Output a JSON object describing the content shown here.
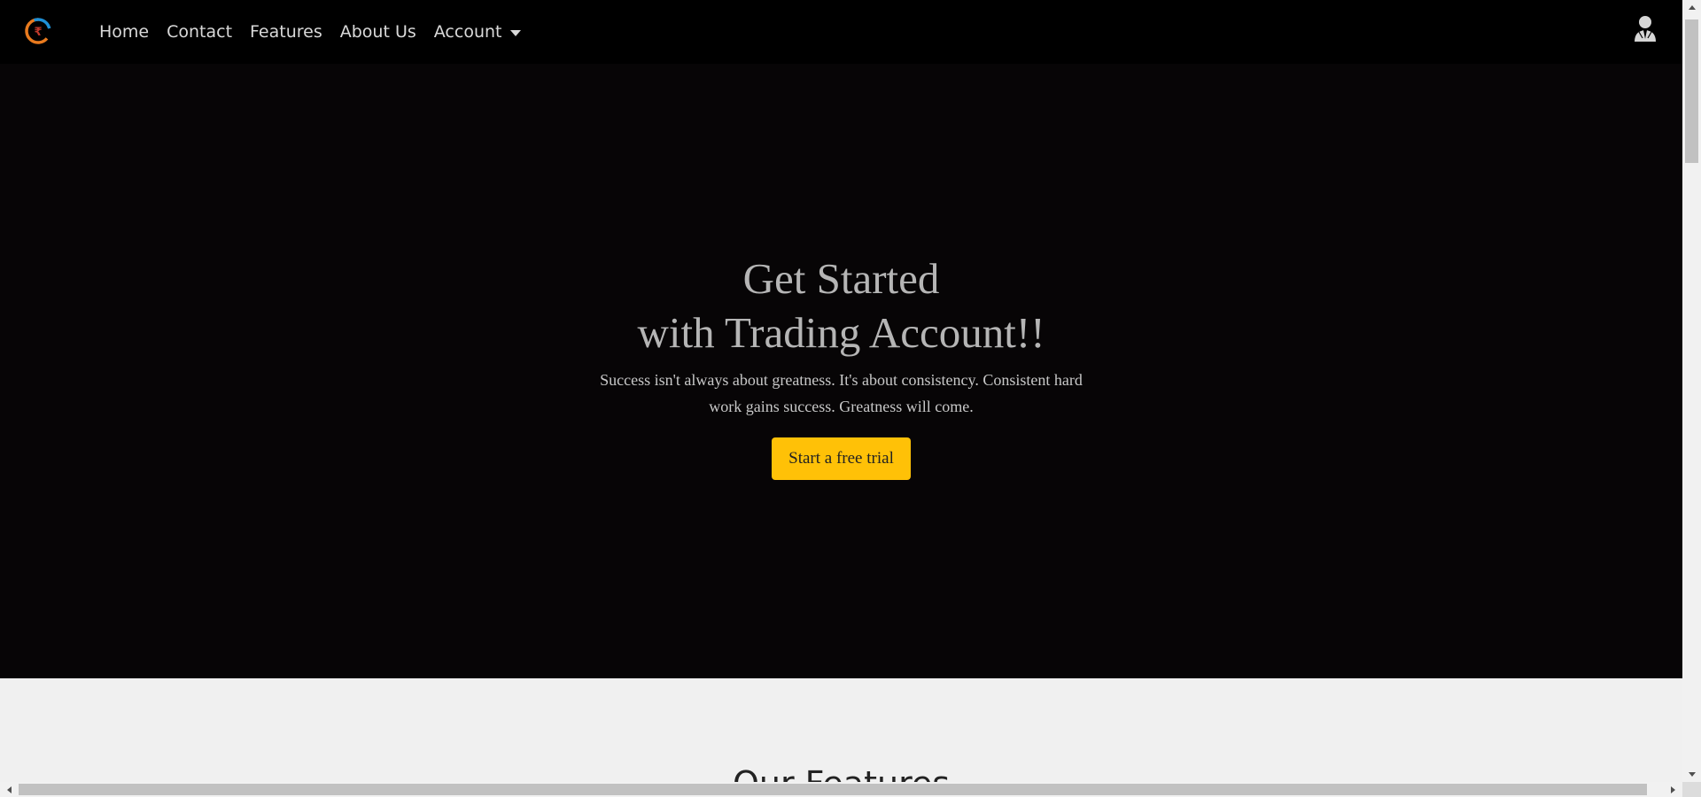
{
  "navbar": {
    "logo_icon": "brand-logo-icon",
    "links": [
      {
        "label": "Home"
      },
      {
        "label": "Contact"
      },
      {
        "label": "Features"
      },
      {
        "label": "About Us"
      }
    ],
    "account_dropdown": {
      "label": "Account",
      "icon": "chevron-down-icon"
    },
    "user_icon": "user-icon"
  },
  "hero": {
    "title_line1": "Get Started",
    "title_line2": "with Trading Account!!",
    "text": "Success isn't always about greatness. It's about consistency. Consistent hard work gains success. Greatness will come.",
    "cta_label": "Start a free trial"
  },
  "features": {
    "title": "Our Features"
  },
  "colors": {
    "navbar_bg": "#000000",
    "hero_bg": "#070506",
    "cta_bg": "#ffc107",
    "section_bg": "#f0f0f0",
    "text_muted": "#b5b5b5"
  }
}
